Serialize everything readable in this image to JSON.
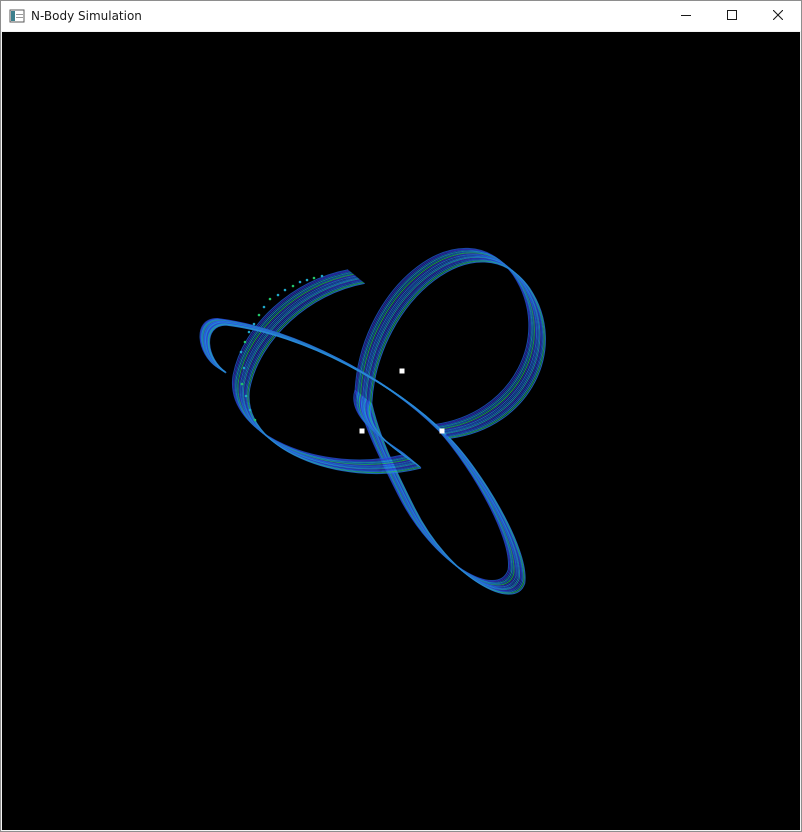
{
  "window": {
    "title": "N-Body Simulation",
    "icon": "app-window-icon",
    "controls": [
      "minimize-icon",
      "maximize-icon",
      "close-icon"
    ]
  },
  "scene": {
    "background": "#000000",
    "trail_colors": [
      "#1e5fd8",
      "#2b7bf0",
      "#3a2fd0",
      "#1fa7c8",
      "#22c46a"
    ],
    "body_color": "#ffffff",
    "body_count": 3
  }
}
